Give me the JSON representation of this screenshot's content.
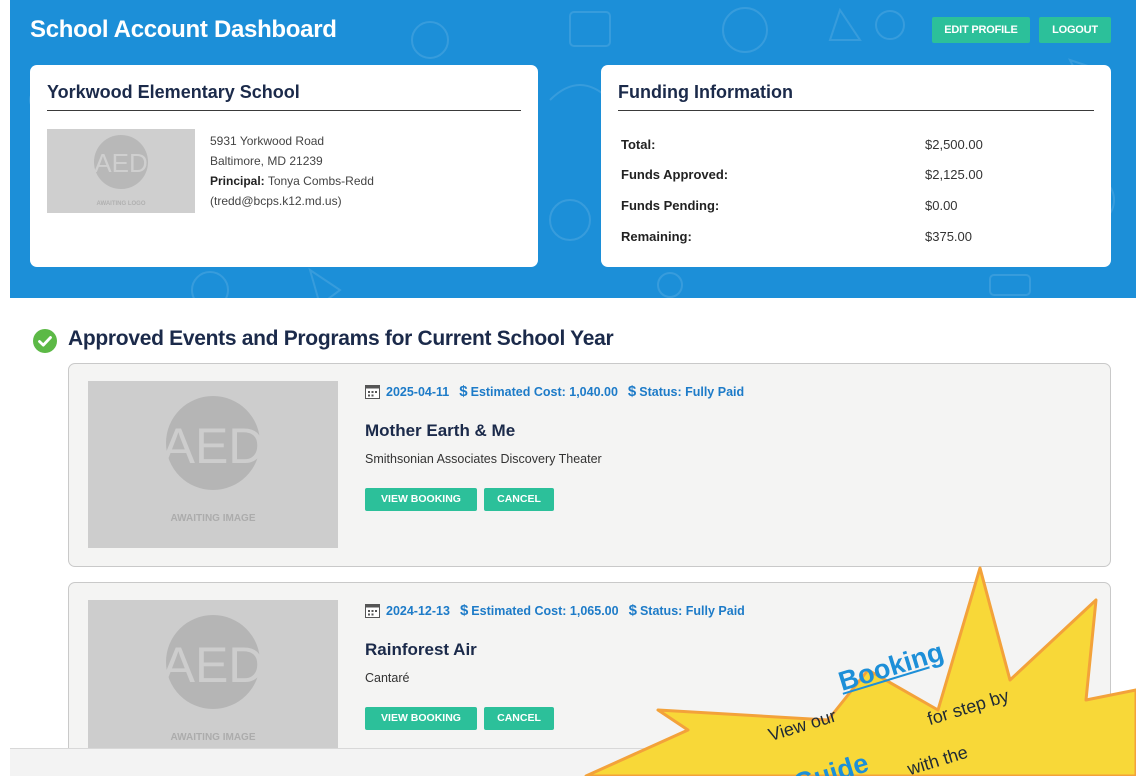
{
  "header": {
    "title": "School Account Dashboard",
    "edit_profile": "EDIT PROFILE",
    "logout": "LOGOUT"
  },
  "school": {
    "name": "Yorkwood Elementary School",
    "logo_text": "AED",
    "logo_caption": "AWAITING LOGO",
    "address_line1": "5931 Yorkwood Road",
    "address_line2": "Baltimore, MD 21239",
    "principal_label": "Principal:",
    "principal_name": "Tonya Combs-Redd",
    "principal_email": "(tredd@bcps.k12.md.us)"
  },
  "funding": {
    "title": "Funding Information",
    "rows": [
      {
        "label": "Total:",
        "value": "$2,500.00"
      },
      {
        "label": "Funds Approved:",
        "value": "$2,125.00"
      },
      {
        "label": "Funds Pending:",
        "value": "$0.00"
      },
      {
        "label": "Remaining:",
        "value": "$375.00"
      }
    ]
  },
  "section": {
    "title": "Approved Events and Programs for Current School Year"
  },
  "events": [
    {
      "date": "2025-04-11",
      "cost": "Estimated Cost: 1,040.00",
      "status": "Status: Fully Paid",
      "title": "Mother Earth & Me",
      "org": "Smithsonian Associates Discovery Theater",
      "image_text": "AED",
      "image_caption": "AWAITING IMAGE",
      "view_label": "VIEW BOOKING",
      "cancel_label": "CANCEL"
    },
    {
      "date": "2024-12-13",
      "cost": "Estimated Cost: 1,065.00",
      "status": "Status: Fully Paid",
      "title": "Rainforest Air",
      "org": "Cantaré",
      "image_text": "AED",
      "image_caption": "AWAITING IMAGE",
      "view_label": "VIEW BOOKING",
      "cancel_label": "CANCEL"
    }
  ],
  "promo": {
    "view_our": "View our",
    "booking": "Booking",
    "for_step_by": "for step by",
    "guide": "Guide",
    "with_the": "with the"
  },
  "colors": {
    "hero_blue": "#1c8fd8",
    "button_green": "#2cc09a",
    "meta_blue": "#1d7bc8",
    "star_yellow": "#f8d838",
    "star_orange": "#f3a23a"
  }
}
